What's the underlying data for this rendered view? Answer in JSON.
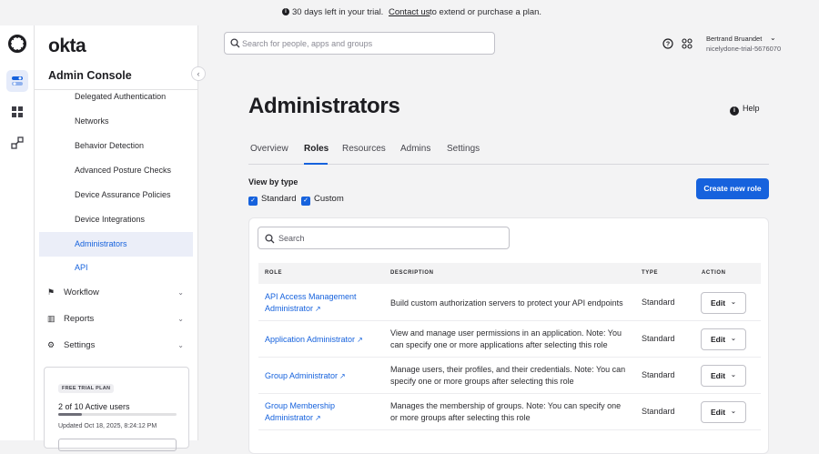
{
  "banner": {
    "trial_text": "30 days left in your trial.",
    "contact_link": "Contact us",
    "plan_text": "to extend or purchase a plan."
  },
  "sidebar": {
    "logo": "okta",
    "console_title": "Admin Console",
    "items": [
      {
        "label": "Delegated Authentication"
      },
      {
        "label": "Networks"
      },
      {
        "label": "Behavior Detection"
      },
      {
        "label": "Advanced Posture Checks"
      },
      {
        "label": "Device Assurance Policies"
      },
      {
        "label": "Device Integrations"
      },
      {
        "label": "Administrators"
      },
      {
        "label": "API"
      }
    ],
    "groups": [
      {
        "label": "Workflow",
        "icon": "workflow-icon"
      },
      {
        "label": "Reports",
        "icon": "reports-icon"
      },
      {
        "label": "Settings",
        "icon": "settings-icon"
      }
    ],
    "trial": {
      "badge": "FREE TRIAL PLAN",
      "users": "2 of 10 Active users",
      "users_fraction": 0.2,
      "updated": "Updated Oct 18, 2025, 8:24:12 PM"
    }
  },
  "topbar": {
    "search_placeholder": "Search for people, apps and groups",
    "user_name": "Bertrand Bruandet",
    "org": "nicelydone-trial-5676070"
  },
  "main": {
    "title": "Administrators",
    "help": "Help",
    "tabs": [
      "Overview",
      "Roles",
      "Resources",
      "Admins",
      "Settings"
    ],
    "active_tab": "Roles",
    "view_by": "View by type",
    "filters": [
      {
        "label": "Standard",
        "checked": true
      },
      {
        "label": "Custom",
        "checked": true
      }
    ],
    "create_button": "Create new role",
    "table_search_placeholder": "Search",
    "columns": [
      "ROLE",
      "DESCRIPTION",
      "TYPE",
      "ACTION"
    ],
    "rows": [
      {
        "role": "API Access Management Administrator",
        "description": "Build custom authorization servers to protect your API endpoints",
        "type": "Standard",
        "action": "Edit"
      },
      {
        "role": "Application Administrator",
        "description": "View and manage user permissions in an application. Note: You can specify one or more applications after selecting this role",
        "type": "Standard",
        "action": "Edit"
      },
      {
        "role": "Group Administrator",
        "description": "Manage users, their profiles, and their credentials. Note: You can specify one or more groups after selecting this role",
        "type": "Standard",
        "action": "Edit"
      },
      {
        "role": "Group Membership Administrator",
        "description": "Manages the membership of groups. Note: You can specify one or more groups after selecting this role",
        "type": "Standard",
        "action": "Edit"
      }
    ]
  }
}
